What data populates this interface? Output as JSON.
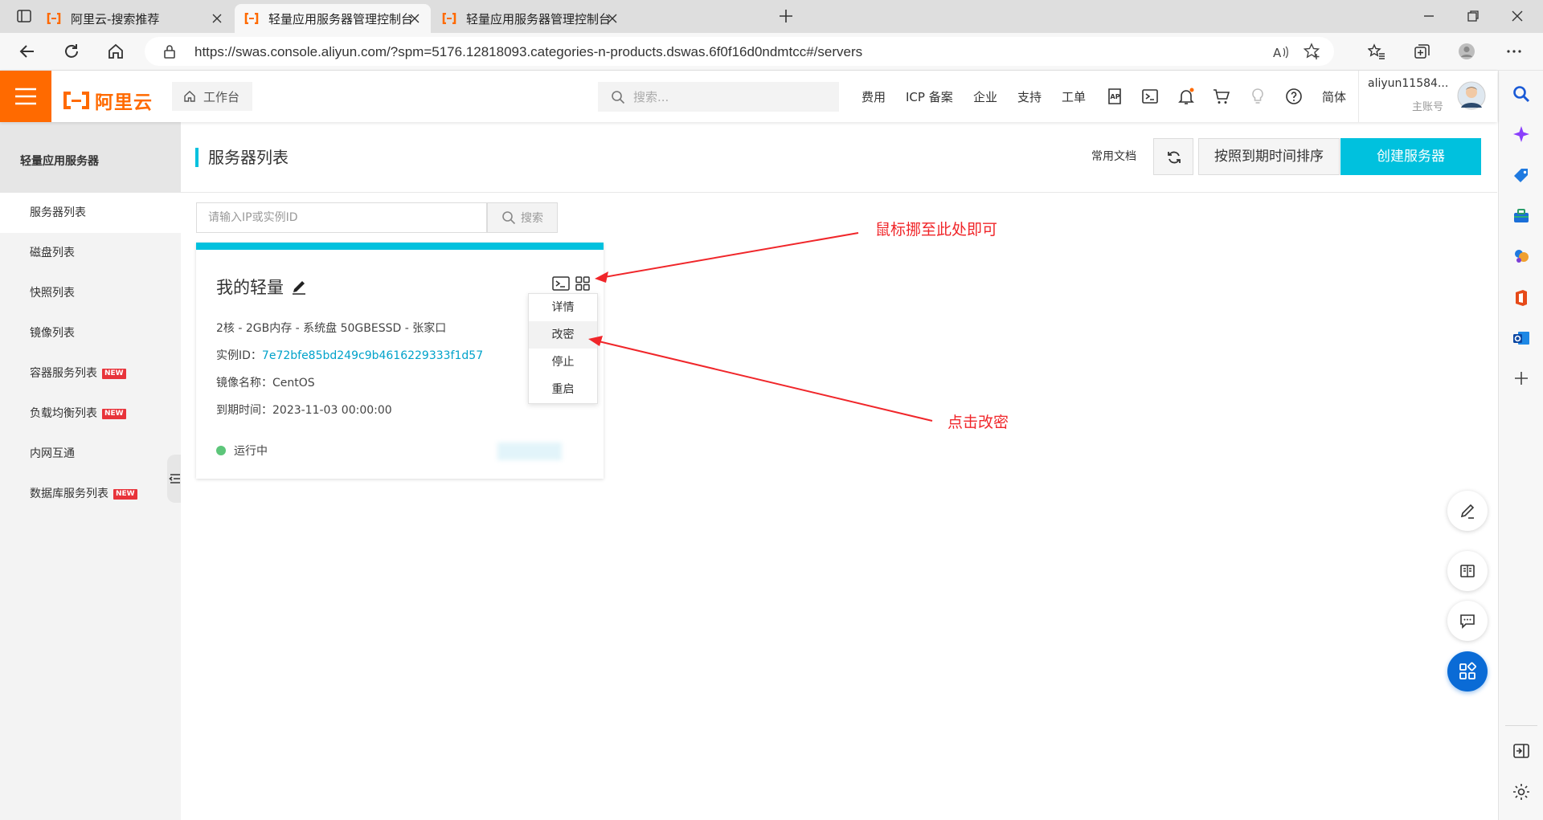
{
  "browser": {
    "tabs": [
      {
        "title": "阿里云-搜索推荐",
        "active": false
      },
      {
        "title": "轻量应用服务器管理控制台",
        "active": true
      },
      {
        "title": "轻量应用服务器管理控制台",
        "active": false
      }
    ],
    "url": "https://swas.console.aliyun.com/?spm=5176.12818093.categories-n-products.dswas.6f0f16d0ndmtcc#/servers"
  },
  "header": {
    "logo_text": "阿里云",
    "workbench": "工作台",
    "search_placeholder": "搜索...",
    "nav": [
      "费用",
      "ICP 备案",
      "企业",
      "支持",
      "工单"
    ],
    "lang": "简体",
    "account_name": "aliyun11584...",
    "account_role": "主账号",
    "brand_color": "#ff6a00"
  },
  "sidebar": {
    "title": "轻量应用服务器",
    "items": [
      {
        "label": "服务器列表",
        "active": true,
        "badge": ""
      },
      {
        "label": "磁盘列表",
        "active": false,
        "badge": ""
      },
      {
        "label": "快照列表",
        "active": false,
        "badge": ""
      },
      {
        "label": "镜像列表",
        "active": false,
        "badge": ""
      },
      {
        "label": "容器服务列表",
        "active": false,
        "badge": "NEW"
      },
      {
        "label": "负载均衡列表",
        "active": false,
        "badge": "NEW"
      },
      {
        "label": "内网互通",
        "active": false,
        "badge": ""
      },
      {
        "label": "数据库服务列表",
        "active": false,
        "badge": "NEW"
      }
    ]
  },
  "main": {
    "title": "服务器列表",
    "docs": "常用文档",
    "sort_button": "按照到期时间排序",
    "create_button": "创建服务器",
    "search_placeholder": "请输入IP或实例ID",
    "search_button": "搜索",
    "accent_color": "#00c1de",
    "server": {
      "name": "我的轻量",
      "specs": "2核 - 2GB内存 - 系统盘 50GBESSD - 张家口",
      "id_label": "实例ID：",
      "id": "7e72bfe85bd249c9b4616229333f1d57",
      "image_label": "镜像名称：",
      "image": "CentOS",
      "expire_label": "到期时间：",
      "expire": "2023-11-03 00:00:00",
      "status": "运行中"
    },
    "menu": [
      "详情",
      "改密",
      "停止",
      "重启"
    ]
  },
  "annotations": {
    "hover_hint": "鼠标挪至此处即可",
    "click_hint": "点击改密"
  }
}
